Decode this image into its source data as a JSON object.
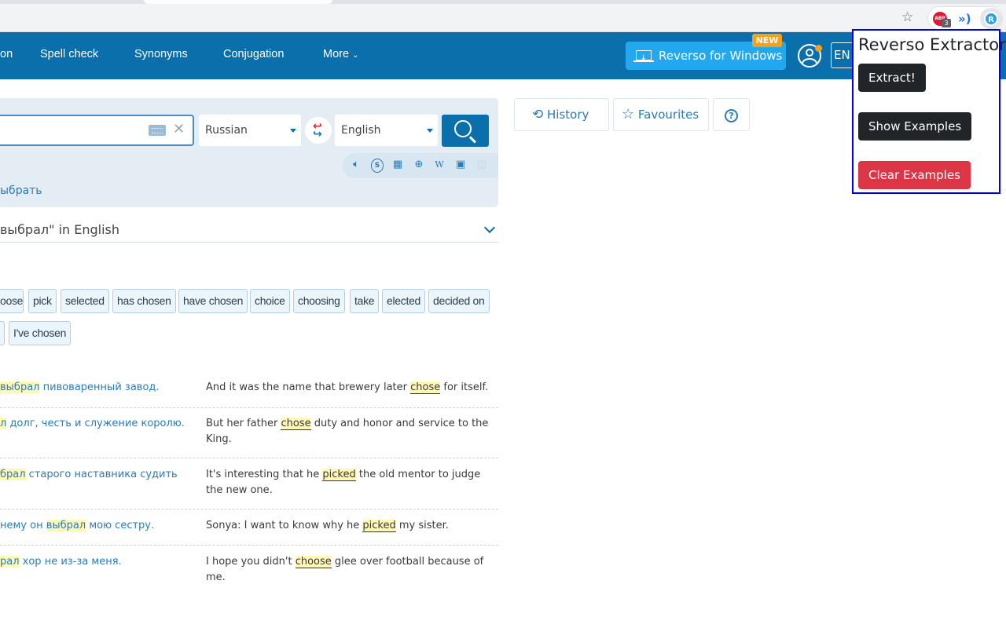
{
  "browser": {
    "bookmark_icon": "star-icon",
    "extensions": [
      {
        "name": "adblock-plus",
        "label": "ABP",
        "badge": "3"
      },
      {
        "name": "read-aloud",
        "label": "»)"
      },
      {
        "name": "reverso-extractor",
        "label": "R"
      }
    ]
  },
  "nav": {
    "links": [
      "on",
      "Spell check",
      "Synonyms",
      "Conjugation",
      "More"
    ],
    "windows_button": "Reverso for Windows",
    "new_badge": "NEW",
    "language": "EN"
  },
  "search": {
    "input_value": "",
    "source_language": "Russian",
    "target_language": "English",
    "tools": [
      "speaker-icon",
      "skype-icon",
      "table-icon",
      "globe-icon",
      "wikipedia-icon",
      "image-icon",
      "book-icon"
    ],
    "query_link": "ыбрать"
  },
  "side_buttons": {
    "history": "History",
    "favourites": "Favourites",
    "help": "?"
  },
  "translations": {
    "header": "выбрал\" in English",
    "chips": [
      "oose",
      "pick",
      "selected",
      "has chosen",
      "have chosen",
      "choice",
      "choosing",
      "take",
      "elected",
      "decided on",
      "",
      "I've chosen"
    ]
  },
  "examples": [
    {
      "src_pre": "",
      "src_hl": "выбрал",
      "src_post": " пивоваренный завод.",
      "trg_pre": "And it was the name that brewery later ",
      "trg_hl": "chose",
      "trg_post": " for itself."
    },
    {
      "src_pre": "",
      "src_hl": "л",
      "src_post": " долг, честь и служение королю.",
      "trg_pre": "But her father ",
      "trg_hl": "chose",
      "trg_post": " duty and honor and service to the King."
    },
    {
      "src_pre": "",
      "src_hl": "брал",
      "src_post": " старого наставника судить",
      "trg_pre": "It's interesting that he ",
      "trg_hl": "picked",
      "trg_post": " the old mentor to judge the new one."
    },
    {
      "src_pre": "нему он ",
      "src_hl": "выбрал",
      "src_post": " мою сестру.",
      "trg_pre": "Sonya: I want to know why he ",
      "trg_hl": "picked",
      "trg_post": " my sister."
    },
    {
      "src_pre": "",
      "src_hl": "рал",
      "src_post": " хор не из-за меня.",
      "trg_pre": "I hope you didn't ",
      "trg_hl": "choose",
      "trg_post": " glee over football because of me."
    }
  ],
  "extension_popup": {
    "title": "Reverso Extractor",
    "extract_button": "Extract!",
    "show_button": "Show Examples",
    "clear_button": "Clear Examples",
    "colors": {
      "dark": "#212529",
      "danger": "#dc3545",
      "border": "#0000dd"
    }
  }
}
